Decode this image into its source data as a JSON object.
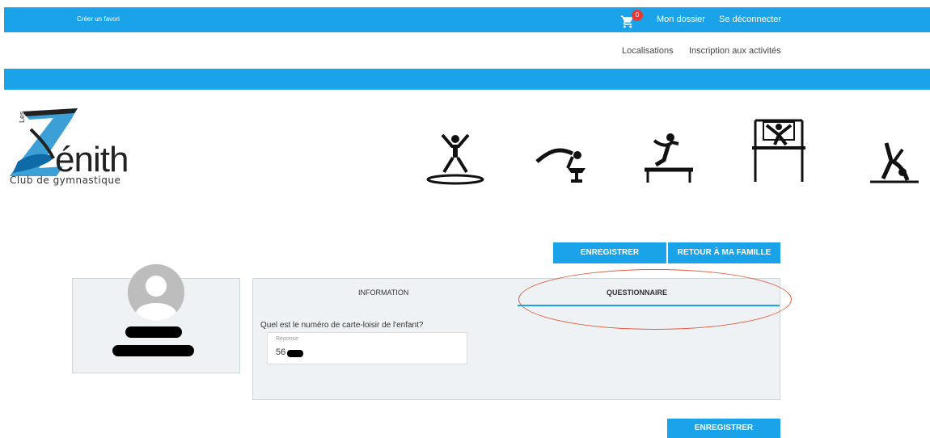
{
  "topbar": {
    "favorite_link": "Créer un favori",
    "cart_count": "0",
    "my_file": "Mon dossier",
    "logout": "Se déconnecter"
  },
  "subnav": {
    "locations": "Localisations",
    "activities": "Inscription aux activités"
  },
  "logo": {
    "les": "Les",
    "name": "énith",
    "subtitle": "Club de gymnastique"
  },
  "gym_icons": [
    "trampoline-icon",
    "vault-icon",
    "balance-beam-icon",
    "uneven-bars-icon",
    "floor-cartwheel-icon"
  ],
  "actions": {
    "save": "ENREGISTRER",
    "back_family": "RETOUR À MA FAMILLE",
    "save_bottom": "ENREGISTRER"
  },
  "tabs": {
    "information": "INFORMATION",
    "questionnaire": "QUESTIONNAIRE"
  },
  "form": {
    "question": "Quel est le numéro de carte-loisir de l'enfant?",
    "answer_label": "Réponse",
    "answer_value": "56"
  },
  "colors": {
    "brand": "#1aa3e8",
    "badge": "#e53935",
    "annotation": "#e45a3c"
  }
}
